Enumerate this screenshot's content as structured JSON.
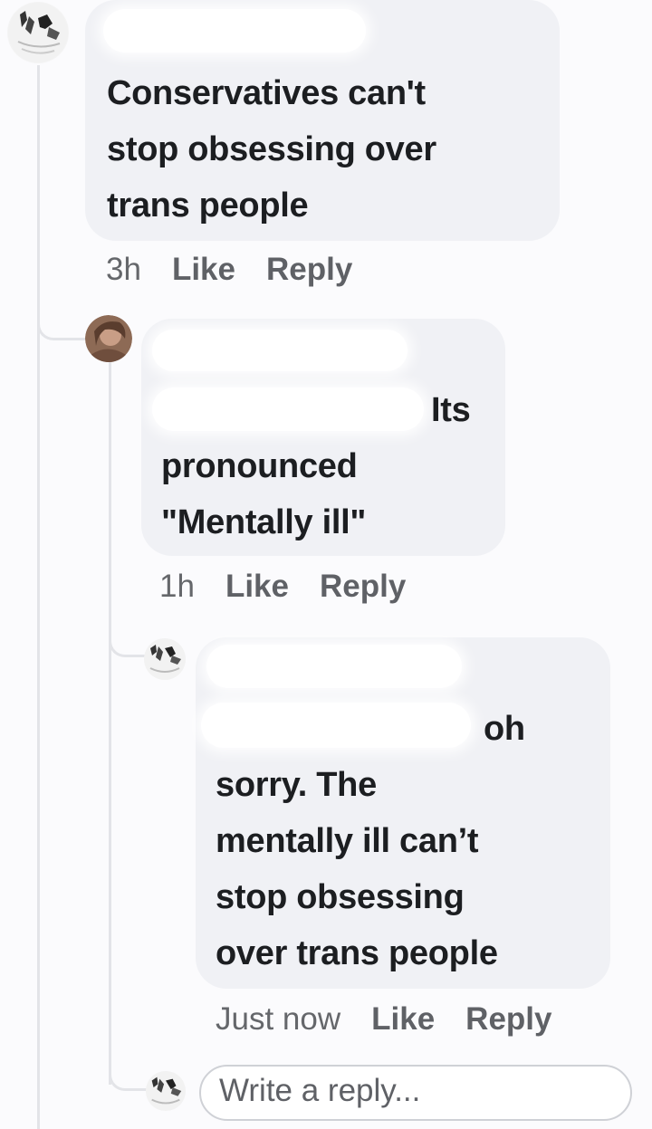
{
  "thread": {
    "comments": [
      {
        "lines": [
          "Conservatives can't",
          "stop obsessing over",
          "trans people"
        ],
        "time": "3h",
        "like_label": "Like",
        "reply_label": "Reply",
        "avatar": "sketch-avatar-icon"
      },
      {
        "first_line": "Its",
        "lines": [
          "pronounced",
          "\"Mentally ill\""
        ],
        "time": "1h",
        "like_label": "Like",
        "reply_label": "Reply",
        "avatar": "brown-photo-avatar-icon"
      },
      {
        "first_line": "oh",
        "lines": [
          "sorry. The",
          "mentally ill can’t",
          "stop obsessing",
          "over trans people"
        ],
        "time": "Just now",
        "like_label": "Like",
        "reply_label": "Reply",
        "avatar": "sketch-avatar-icon"
      }
    ],
    "composer": {
      "placeholder": "Write a reply...",
      "avatar": "sketch-avatar-icon"
    }
  },
  "colors": {
    "bubble": "#f0f1f5",
    "text": "#1c1e21",
    "action_text": "#5f6166",
    "thread_line": "#e3e4e8"
  }
}
